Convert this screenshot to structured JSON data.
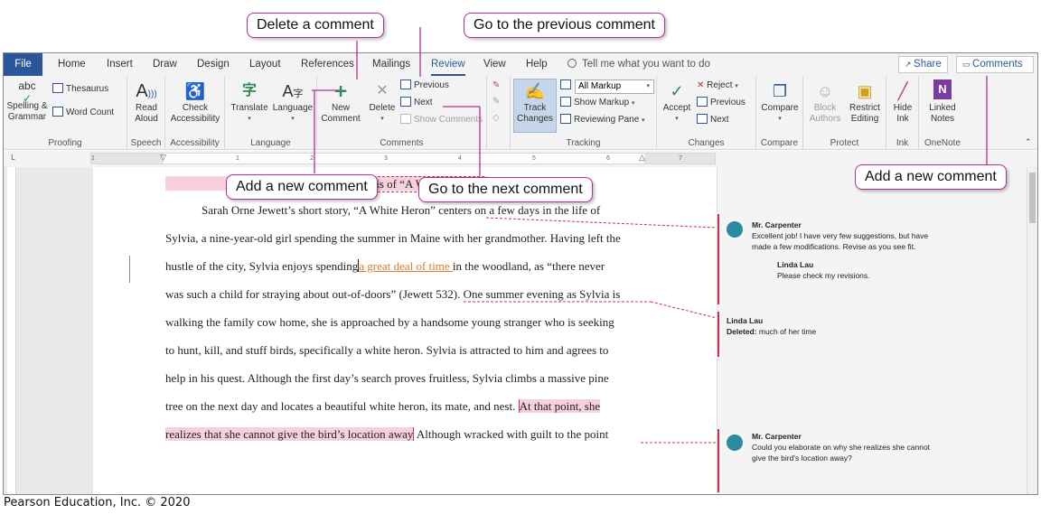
{
  "tabs": [
    "File",
    "Home",
    "Insert",
    "Draw",
    "Design",
    "Layout",
    "References",
    "Mailings",
    "Review",
    "View",
    "Help"
  ],
  "tell_me": "Tell me what you want to do",
  "share_label": "Share",
  "comments_label": "Comments",
  "ribbon": {
    "proofing": {
      "spelling": "Spelling &",
      "grammar": "Grammar",
      "thesaurus": "Thesaurus",
      "word_count": "Word Count",
      "group": "Proofing",
      "abc": "abc"
    },
    "speech": {
      "read": "Read",
      "aloud": "Aloud",
      "group": "Speech"
    },
    "accessibility": {
      "check": "Check",
      "access": "Accessibility",
      "group": "Accessibility"
    },
    "language": {
      "translate": "Translate",
      "language": "Language",
      "group": "Language"
    },
    "comments": {
      "new": "New",
      "comment": "Comment",
      "delete": "Delete",
      "previous": "Previous",
      "next": "Next",
      "show": "Show Comments",
      "group": "Comments"
    },
    "tracking": {
      "track": "Track",
      "changes": "Changes",
      "markup_select": "All Markup",
      "show_markup": "Show Markup",
      "reviewing_pane": "Reviewing Pane",
      "group": "Tracking"
    },
    "changes": {
      "accept": "Accept",
      "reject": "Reject",
      "previous": "Previous",
      "next": "Next",
      "group": "Changes"
    },
    "compare": {
      "compare": "Compare",
      "group": "Compare"
    },
    "protect": {
      "block": "Block",
      "authors": "Authors",
      "restrict": "Restrict",
      "editing": "Editing",
      "group": "Protect"
    },
    "ink": {
      "hide": "Hide",
      "ink": "Ink",
      "group": "Ink"
    },
    "onenote": {
      "linked": "Linked",
      "notes": "Notes",
      "group": "OneNote"
    }
  },
  "ruler_numbers": [
    "1",
    "1",
    "2",
    "3",
    "4",
    "5",
    "6",
    "7"
  ],
  "document": {
    "title": "An Analysis of “A White Heron”",
    "lines": [
      {
        "pre": "Sarah Orne Jewett’s short story, “A White Heron” centers on a few days in the life of"
      },
      {
        "pre": "Sylvia, a nine-year-old girl spending the summer in Maine with her grandmother. Having left the"
      },
      {
        "pre": "hustle of the city, Sylvia enjoys spending",
        "ins": "a great deal of time ",
        "post": "in the woodland, as “there never"
      },
      {
        "pre": "was such a child for straying about out-of-doors” (Jewett 532).  One summer evening as Sylvia is"
      },
      {
        "pre": "walking the family cow home, she is approached by a handsome young stranger who is seeking"
      },
      {
        "pre": "to hunt, kill, and stuff birds, specifically a white heron. Sylvia is attracted to him and agrees to"
      },
      {
        "pre": "help in his quest. Although the first day’s search proves fruitless, Sylvia climbs a massive pine"
      },
      {
        "pre": "tree on the next day and locates a beautiful white heron, its mate, and nest.",
        "hl": "At that point, she"
      },
      {
        "hl": "realizes that she cannot give the bird’s location away",
        "post": " Although wracked with guilt to the point"
      }
    ]
  },
  "margin_comments": [
    {
      "author": "Mr. Carpenter",
      "text1": "Excellent job! I have very few suggestions, but have",
      "text2": "made a few modifications. Revise as you see fit."
    },
    {
      "author": "Linda Lau",
      "text1": "Please check my revisions."
    },
    {
      "author": "Linda Lau",
      "deleted_label": "Deleted:",
      "deleted_text": "much of her time"
    },
    {
      "author": "Mr. Carpenter",
      "text1": "Could you elaborate on why she realizes she cannot",
      "text2": "give the bird’s location away?"
    }
  ],
  "callouts": {
    "delete": "Delete a comment",
    "previous": "Go to the previous comment",
    "new": "Add a new comment",
    "next": "Go to the next comment",
    "add_new": "Add a new comment"
  },
  "credit": "Pearson Education, Inc. © 2020",
  "colors": {
    "brand": "#2b579a",
    "callout_border": "#b0318c",
    "comment_red": "#d03050",
    "insert_orange": "#e07a2a",
    "highlight": "#f6d0dd"
  }
}
